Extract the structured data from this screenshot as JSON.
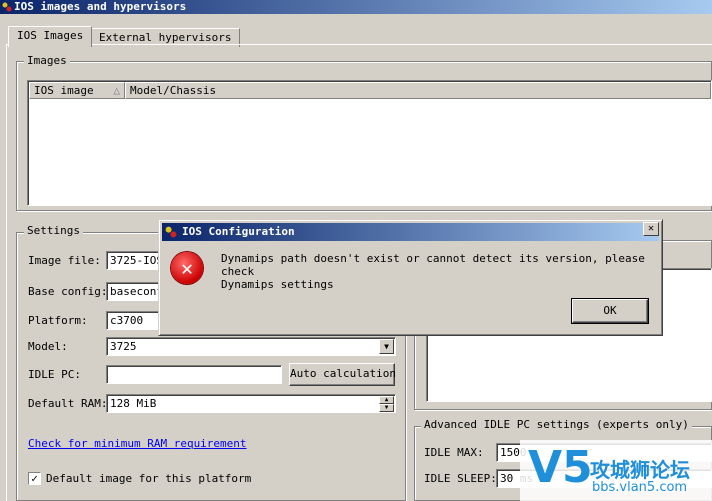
{
  "window": {
    "title": "IOS images and hypervisors"
  },
  "tabs": [
    {
      "label": "IOS Images",
      "active": true
    },
    {
      "label": "External hypervisors",
      "active": false
    }
  ],
  "images_group": {
    "label": "Images",
    "columns": [
      "IOS image",
      "Model/Chassis"
    ]
  },
  "settings": {
    "label": "Settings",
    "image_file_label": "Image file:",
    "image_file_value": "3725-IOS",
    "base_config_label": "Base config:",
    "base_config_value": "baseconf",
    "platform_label": "Platform:",
    "platform_value": "c3700",
    "model_label": "Model:",
    "model_value": "3725",
    "idle_pc_label": "IDLE PC:",
    "idle_pc_value": "",
    "auto_calc_label": "Auto calculation",
    "default_ram_label": "Default RAM:",
    "default_ram_value": "128 MiB",
    "min_ram_link": "Check for minimum RAM requirement",
    "default_image_label": "Default image for this platform",
    "default_image_checked": true
  },
  "advanced": {
    "label": "Advanced IDLE PC settings (experts only)",
    "idle_max_label": "IDLE MAX:",
    "idle_max_value": "1500",
    "idle_sleep_label": "IDLE SLEEP:",
    "idle_sleep_value": "30 ms"
  },
  "dialog": {
    "title": "IOS Configuration",
    "message_line1": "Dynamips path doesn't exist or cannot detect its version, please check",
    "message_line2": "Dynamips settings",
    "ok_label": "OK",
    "close_glyph": "✕",
    "icon": "error-icon"
  },
  "watermark": {
    "logo": "V5",
    "text": "攻城狮论坛",
    "url": "bbs.vlan5.com"
  }
}
